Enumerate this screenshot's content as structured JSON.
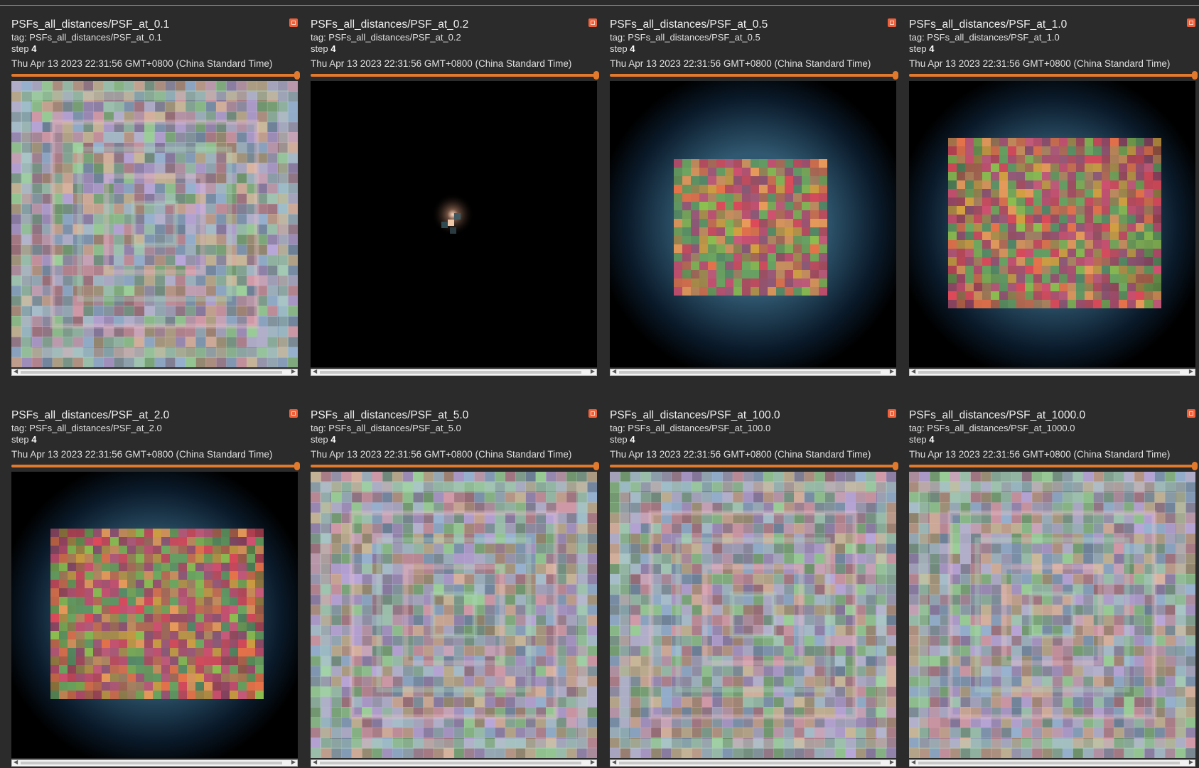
{
  "cards": [
    {
      "title": "PSFs_all_distances/PSF_at_0.1",
      "tag": "tag: PSFs_all_distances/PSF_at_0.1",
      "step_label": "step",
      "step_value": "4",
      "timestamp": "Thu Apr 13 2023 22:31:56 GMT+0800 (China Standard Time)",
      "pattern": "grid-pastel",
      "image_shows": "pastel checker grid"
    },
    {
      "title": "PSFs_all_distances/PSF_at_0.2",
      "tag": "tag: PSFs_all_distances/PSF_at_0.2",
      "step_label": "step",
      "step_value": "4",
      "timestamp": "Thu Apr 13 2023 22:31:56 GMT+0800 (China Standard Time)",
      "pattern": "point",
      "image_shows": "small bright point on black"
    },
    {
      "title": "PSFs_all_distances/PSF_at_0.5",
      "tag": "tag: PSFs_all_distances/PSF_at_0.5",
      "step_label": "step",
      "step_value": "4",
      "timestamp": "Thu Apr 13 2023 22:31:56 GMT+0800 (China Standard Time)",
      "pattern": "blob-small",
      "image_shows": "small colorful blurred square"
    },
    {
      "title": "PSFs_all_distances/PSF_at_1.0",
      "tag": "tag: PSFs_all_distances/PSF_at_1.0",
      "step_label": "step",
      "step_value": "4",
      "timestamp": "Thu Apr 13 2023 22:31:56 GMT+0800 (China Standard Time)",
      "pattern": "blob-large",
      "image_shows": "large colorful blurred square"
    },
    {
      "title": "PSFs_all_distances/PSF_at_2.0",
      "tag": "tag: PSFs_all_distances/PSF_at_2.0",
      "step_label": "step",
      "step_value": "4",
      "timestamp": "Thu Apr 13 2023 22:31:56 GMT+0800 (China Standard Time)",
      "pattern": "blob-large",
      "image_shows": "large colorful blurred square"
    },
    {
      "title": "PSFs_all_distances/PSF_at_5.0",
      "tag": "tag: PSFs_all_distances/PSF_at_5.0",
      "step_label": "step",
      "step_value": "4",
      "timestamp": "Thu Apr 13 2023 22:31:56 GMT+0800 (China Standard Time)",
      "pattern": "grid-pastel",
      "image_shows": "pastel checker grid"
    },
    {
      "title": "PSFs_all_distances/PSF_at_100.0",
      "tag": "tag: PSFs_all_distances/PSF_at_100.0",
      "step_label": "step",
      "step_value": "4",
      "timestamp": "Thu Apr 13 2023 22:31:56 GMT+0800 (China Standard Time)",
      "pattern": "grid-pastel",
      "image_shows": "pastel checker grid"
    },
    {
      "title": "PSFs_all_distances/PSF_at_1000.0",
      "tag": "tag: PSFs_all_distances/PSF_at_1000.0",
      "step_label": "step",
      "step_value": "4",
      "timestamp": "Thu Apr 13 2023 22:31:56 GMT+0800 (China Standard Time)",
      "pattern": "grid-pastel",
      "image_shows": "pastel checker grid"
    }
  ],
  "colors": {
    "background": "#2b2b2b",
    "accent": "#e27a2e",
    "expand_button": "#f0603a"
  },
  "slider_position": 1.0,
  "scrollbar_arrows": {
    "left": "◀",
    "right": "▶"
  }
}
